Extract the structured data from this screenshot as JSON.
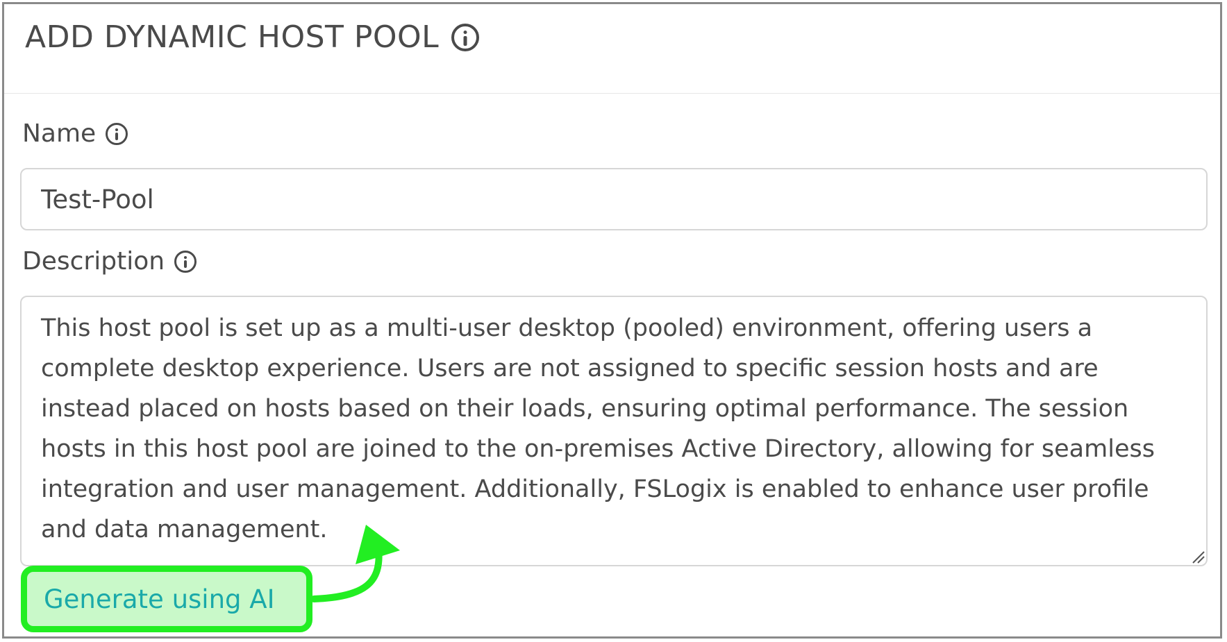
{
  "dialog": {
    "title": "ADD DYNAMIC HOST POOL"
  },
  "fields": {
    "name": {
      "label": "Name",
      "value": "Test-Pool"
    },
    "description": {
      "label": "Description",
      "value": "This host pool is set up as a multi-user desktop (pooled) environment, offering users a complete desktop experience. Users are not assigned to specific session hosts and are instead placed on hosts based on their loads, ensuring optimal performance. The session hosts in this host pool are joined to the on-premises Active Directory, allowing for seamless integration and user management. Additionally, FSLogix is enabled to enhance user profile and data management."
    }
  },
  "actions": {
    "generate_ai_label": "Generate using AI"
  },
  "icons": {
    "title_info": "info-icon",
    "name_info": "info-icon",
    "description_info": "info-icon",
    "annotation_arrow": "curved-arrow-icon"
  },
  "colors": {
    "highlight_border": "#22ee22",
    "highlight_fill": "#c9f9c9",
    "link_text": "#1aa9a9",
    "frame_border": "#8a8a8a"
  }
}
